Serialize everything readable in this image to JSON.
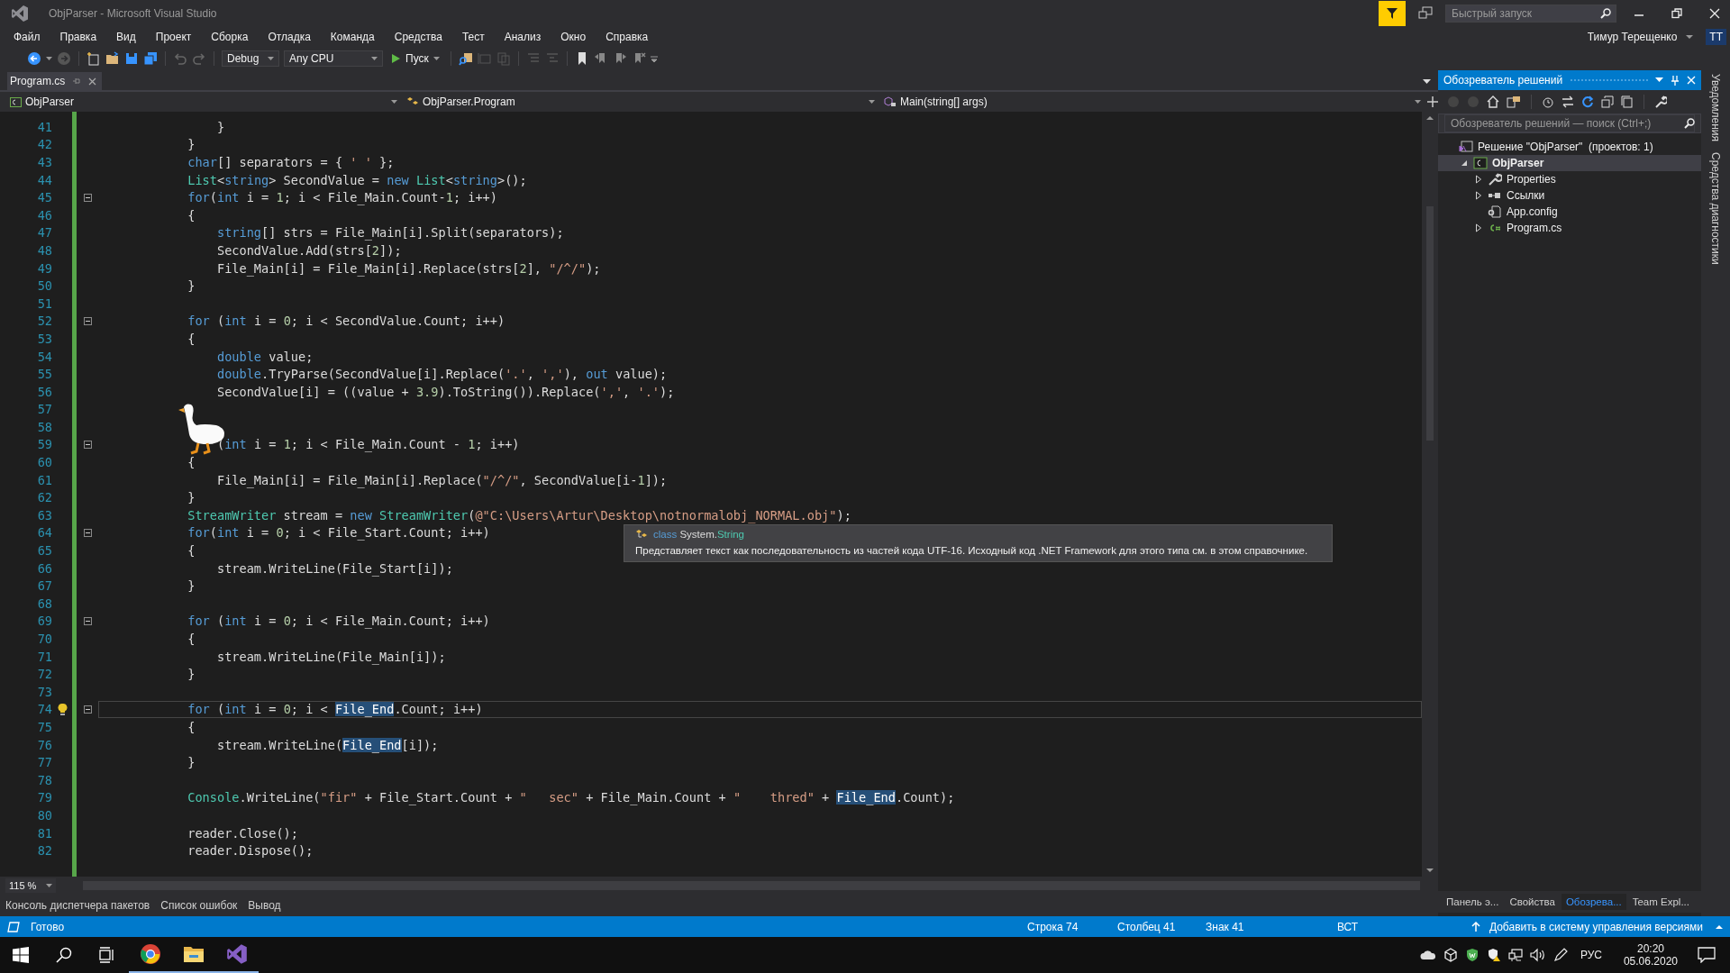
{
  "window": {
    "title": "ObjParser - Microsoft Visual Studio",
    "quick_launch": {
      "placeholder": "Быстрый запуск"
    },
    "user": {
      "name": "Тимур Терещенко",
      "initials": "TT"
    }
  },
  "menu": [
    "Файл",
    "Правка",
    "Вид",
    "Проект",
    "Сборка",
    "Отладка",
    "Команда",
    "Средства",
    "Тест",
    "Анализ",
    "Окно",
    "Справка"
  ],
  "toolbar": {
    "configuration": "Debug",
    "platform": "Any CPU",
    "run_label": "Пуск"
  },
  "document_tabs": [
    {
      "label": "Program.cs",
      "selected": true
    }
  ],
  "navigation": {
    "project": "ObjParser",
    "type": "ObjParser.Program",
    "member": "Main(string[] args)"
  },
  "code": {
    "lines": [
      {
        "number": "41",
        "tokens": [
          {
            "kind": "plain",
            "text": "                }"
          }
        ]
      },
      {
        "number": "42",
        "tokens": [
          {
            "kind": "plain",
            "text": "            }"
          }
        ]
      },
      {
        "number": "43",
        "tokens": [
          {
            "kind": "kw",
            "text": "            char"
          },
          {
            "kind": "plain",
            "text": "[] separators = { "
          },
          {
            "kind": "str",
            "text": "' '"
          },
          {
            "kind": "plain",
            "text": " };"
          }
        ]
      },
      {
        "number": "44",
        "tokens": [
          {
            "kind": "type",
            "text": "            List"
          },
          {
            "kind": "plain",
            "text": "<"
          },
          {
            "kind": "kw",
            "text": "string"
          },
          {
            "kind": "plain",
            "text": "> SecondValue = "
          },
          {
            "kind": "kw",
            "text": "new"
          },
          {
            "kind": "type",
            "text": " List"
          },
          {
            "kind": "plain",
            "text": "<"
          },
          {
            "kind": "kw",
            "text": "string"
          },
          {
            "kind": "plain",
            "text": ">();"
          }
        ]
      },
      {
        "number": "45",
        "fold": true,
        "tokens": [
          {
            "kind": "kw",
            "text": "            for"
          },
          {
            "kind": "plain",
            "text": "("
          },
          {
            "kind": "kw",
            "text": "int"
          },
          {
            "kind": "plain",
            "text": " i = "
          },
          {
            "kind": "num",
            "text": "1"
          },
          {
            "kind": "plain",
            "text": "; i < File_Main.Count-"
          },
          {
            "kind": "num",
            "text": "1"
          },
          {
            "kind": "plain",
            "text": "; i++)"
          }
        ]
      },
      {
        "number": "46",
        "tokens": [
          {
            "kind": "plain",
            "text": "            {"
          }
        ]
      },
      {
        "number": "47",
        "tokens": [
          {
            "kind": "kw",
            "text": "                string"
          },
          {
            "kind": "plain",
            "text": "[] strs = File_Main[i].Split(separators);"
          }
        ]
      },
      {
        "number": "48",
        "tokens": [
          {
            "kind": "plain",
            "text": "                SecondValue.Add(strs["
          },
          {
            "kind": "num",
            "text": "2"
          },
          {
            "kind": "plain",
            "text": "]);"
          }
        ]
      },
      {
        "number": "49",
        "tokens": [
          {
            "kind": "plain",
            "text": "                File_Main[i] = File_Main[i].Replace(strs["
          },
          {
            "kind": "num",
            "text": "2"
          },
          {
            "kind": "plain",
            "text": "], "
          },
          {
            "kind": "str",
            "text": "\"/^/\""
          },
          {
            "kind": "plain",
            "text": ");"
          }
        ]
      },
      {
        "number": "50",
        "tokens": [
          {
            "kind": "plain",
            "text": "            }"
          }
        ]
      },
      {
        "number": "51"
      },
      {
        "number": "52",
        "fold": true,
        "tokens": [
          {
            "kind": "kw",
            "text": "            for"
          },
          {
            "kind": "plain",
            "text": " ("
          },
          {
            "kind": "kw",
            "text": "int"
          },
          {
            "kind": "plain",
            "text": " i = "
          },
          {
            "kind": "num",
            "text": "0"
          },
          {
            "kind": "plain",
            "text": "; i < SecondValue.Count; i++)"
          }
        ]
      },
      {
        "number": "53",
        "tokens": [
          {
            "kind": "plain",
            "text": "            {"
          }
        ]
      },
      {
        "number": "54",
        "tokens": [
          {
            "kind": "kw",
            "text": "                double"
          },
          {
            "kind": "plain",
            "text": " value;"
          }
        ]
      },
      {
        "number": "55",
        "tokens": [
          {
            "kind": "kw",
            "text": "                double"
          },
          {
            "kind": "plain",
            "text": ".TryParse(SecondValue[i].Replace("
          },
          {
            "kind": "str",
            "text": "'.'"
          },
          {
            "kind": "plain",
            "text": ", "
          },
          {
            "kind": "str",
            "text": "','"
          },
          {
            "kind": "plain",
            "text": "), "
          },
          {
            "kind": "kw",
            "text": "out"
          },
          {
            "kind": "plain",
            "text": " value);"
          }
        ]
      },
      {
        "number": "56",
        "tokens": [
          {
            "kind": "plain",
            "text": "                SecondValue[i] = ((value + "
          },
          {
            "kind": "num",
            "text": "3.9"
          },
          {
            "kind": "plain",
            "text": ").ToString()).Replace("
          },
          {
            "kind": "str",
            "text": "','"
          },
          {
            "kind": "plain",
            "text": ", "
          },
          {
            "kind": "str",
            "text": "'.'"
          },
          {
            "kind": "plain",
            "text": ");"
          }
        ]
      },
      {
        "number": "57"
      },
      {
        "number": "58"
      },
      {
        "number": "59",
        "fold": true,
        "tokens": [
          {
            "kind": "plain",
            "text": "                ("
          },
          {
            "kind": "kw",
            "text": "int"
          },
          {
            "kind": "plain",
            "text": " i = "
          },
          {
            "kind": "num",
            "text": "1"
          },
          {
            "kind": "plain",
            "text": "; i < File_Main.Count - "
          },
          {
            "kind": "num",
            "text": "1"
          },
          {
            "kind": "plain",
            "text": "; i++)"
          }
        ]
      },
      {
        "number": "60",
        "tokens": [
          {
            "kind": "plain",
            "text": "            {"
          }
        ]
      },
      {
        "number": "61",
        "tokens": [
          {
            "kind": "plain",
            "text": "                File_Main[i] = File_Main[i].Replace("
          },
          {
            "kind": "str",
            "text": "\"/^/\""
          },
          {
            "kind": "plain",
            "text": ", SecondValue[i-"
          },
          {
            "kind": "num",
            "text": "1"
          },
          {
            "kind": "plain",
            "text": "]);"
          }
        ]
      },
      {
        "number": "62",
        "tokens": [
          {
            "kind": "plain",
            "text": "            }"
          }
        ]
      },
      {
        "number": "63",
        "tokens": [
          {
            "kind": "type",
            "text": "            StreamWriter"
          },
          {
            "kind": "plain",
            "text": " stream = "
          },
          {
            "kind": "kw",
            "text": "new"
          },
          {
            "kind": "type",
            "text": " StreamWriter"
          },
          {
            "kind": "plain",
            "text": "("
          },
          {
            "kind": "str",
            "text": "@\"C:\\Users\\Artur\\Desktop\\notnormalobj_NORMAL.obj\""
          },
          {
            "kind": "plain",
            "text": ");"
          }
        ]
      },
      {
        "number": "64",
        "fold": true,
        "tokens": [
          {
            "kind": "kw",
            "text": "            for"
          },
          {
            "kind": "plain",
            "text": "("
          },
          {
            "kind": "kw",
            "text": "int"
          },
          {
            "kind": "plain",
            "text": " i = "
          },
          {
            "kind": "num",
            "text": "0"
          },
          {
            "kind": "plain",
            "text": "; i < File_Start.Count; i++)"
          }
        ]
      },
      {
        "number": "65",
        "tokens": [
          {
            "kind": "plain",
            "text": "            {"
          }
        ]
      },
      {
        "number": "66",
        "tokens": [
          {
            "kind": "plain",
            "text": "                stream.WriteLine(File_Start[i]);"
          }
        ]
      },
      {
        "number": "67",
        "tokens": [
          {
            "kind": "plain",
            "text": "            }"
          }
        ]
      },
      {
        "number": "68"
      },
      {
        "number": "69",
        "fold": true,
        "tokens": [
          {
            "kind": "kw",
            "text": "            for"
          },
          {
            "kind": "plain",
            "text": " ("
          },
          {
            "kind": "kw",
            "text": "int"
          },
          {
            "kind": "plain",
            "text": " i = "
          },
          {
            "kind": "num",
            "text": "0"
          },
          {
            "kind": "plain",
            "text": "; i < File_Main.Count; i++)"
          }
        ]
      },
      {
        "number": "70",
        "tokens": [
          {
            "kind": "plain",
            "text": "            {"
          }
        ]
      },
      {
        "number": "71",
        "tokens": [
          {
            "kind": "plain",
            "text": "                stream.WriteLine(File_Main[i]);"
          }
        ]
      },
      {
        "number": "72",
        "tokens": [
          {
            "kind": "plain",
            "text": "            }"
          }
        ]
      },
      {
        "number": "73"
      },
      {
        "number": "74",
        "fold": true,
        "bulb": true,
        "current": true,
        "tokens": [
          {
            "kind": "kw",
            "text": "            for"
          },
          {
            "kind": "plain",
            "text": " ("
          },
          {
            "kind": "kw",
            "text": "int"
          },
          {
            "kind": "plain",
            "text": " i = "
          },
          {
            "kind": "num",
            "text": "0"
          },
          {
            "kind": "plain",
            "text": "; i < "
          },
          {
            "kind": "ref",
            "text": "File_End"
          },
          {
            "kind": "plain",
            "text": ".Count; i++)"
          }
        ]
      },
      {
        "number": "75",
        "tokens": [
          {
            "kind": "plain",
            "text": "            {"
          }
        ]
      },
      {
        "number": "76",
        "tokens": [
          {
            "kind": "plain",
            "text": "                stream.WriteLine("
          },
          {
            "kind": "ref",
            "text": "File_End"
          },
          {
            "kind": "plain",
            "text": "[i]);"
          }
        ]
      },
      {
        "number": "77",
        "tokens": [
          {
            "kind": "plain",
            "text": "            }"
          }
        ]
      },
      {
        "number": "78"
      },
      {
        "number": "79",
        "tokens": [
          {
            "kind": "type",
            "text": "            Console"
          },
          {
            "kind": "plain",
            "text": ".WriteLine("
          },
          {
            "kind": "str",
            "text": "\"fir\""
          },
          {
            "kind": "plain",
            "text": " + File_Start.Count + "
          },
          {
            "kind": "str",
            "text": "\"   sec\""
          },
          {
            "kind": "plain",
            "text": " + File_Main.Count + "
          },
          {
            "kind": "str",
            "text": "\"    thred\""
          },
          {
            "kind": "plain",
            "text": " + "
          },
          {
            "kind": "ref",
            "text": "File_End"
          },
          {
            "kind": "plain",
            "text": ".Count);"
          }
        ]
      },
      {
        "number": "80"
      },
      {
        "number": "81",
        "tokens": [
          {
            "kind": "plain",
            "text": "            reader.Close();"
          }
        ]
      },
      {
        "number": "82",
        "tokens": [
          {
            "kind": "plain",
            "text": "            reader.Dispose();"
          }
        ]
      }
    ]
  },
  "tooltip": {
    "signature": [
      {
        "kind": "kw",
        "text": "class"
      },
      {
        "kind": "plain",
        "text": " System."
      },
      {
        "kind": "type",
        "text": "String"
      }
    ],
    "description": "Представляет текст как последовательность из частей кода UTF-16. Исходный код .NET Framework для этого типа см. в этом справочнике."
  },
  "zoom": "115 %",
  "tool_tabs": [
    {
      "label": "Консоль диспетчера пакетов",
      "selected": false
    },
    {
      "label": "Список ошибок",
      "selected": false
    },
    {
      "label": "Вывод",
      "selected": false
    }
  ],
  "explorer": {
    "title": "Обозреватель решений",
    "search": {
      "placeholder": "Обозреватель решений — поиск (Ctrl+;)"
    },
    "tree": [
      {
        "label": "Решение \"ObjParser\"  (проектов: 1)",
        "kind": "solution",
        "selected": false,
        "children": [
          {
            "label": "ObjParser",
            "kind": "project",
            "selected": true,
            "expanded": true,
            "children": [
              {
                "label": "Properties",
                "kind": "properties",
                "selected": false,
                "expanded": false
              },
              {
                "label": "Ссылки",
                "kind": "references",
                "selected": false,
                "expanded": false
              },
              {
                "label": "App.config",
                "kind": "config",
                "selected": false
              },
              {
                "label": "Program.cs",
                "kind": "csharp",
                "selected": false,
                "expanded": false
              }
            ]
          }
        ]
      }
    ],
    "tabs": [
      {
        "label": "Панель э...",
        "selected": false
      },
      {
        "label": "Свойства",
        "selected": false
      },
      {
        "label": "Обозрева...",
        "selected": true
      },
      {
        "label": "Team Expl...",
        "selected": false
      }
    ]
  },
  "side_tabs": [
    "Уведомления",
    "Средства диагностики"
  ],
  "status_bar": {
    "message": "Готово",
    "line": "Строка 74",
    "column": "Столбец 41",
    "char": "Знак 41",
    "mode": "ВСТ",
    "source_control": "Добавить в систему управления версиями"
  },
  "taskbar": {
    "apps": [
      {
        "kind": "chrome",
        "running": true
      },
      {
        "kind": "explorer",
        "running": true
      },
      {
        "kind": "studio",
        "running": true
      }
    ],
    "language": "РУС",
    "time": "20:20",
    "date": "05.06.2020"
  }
}
